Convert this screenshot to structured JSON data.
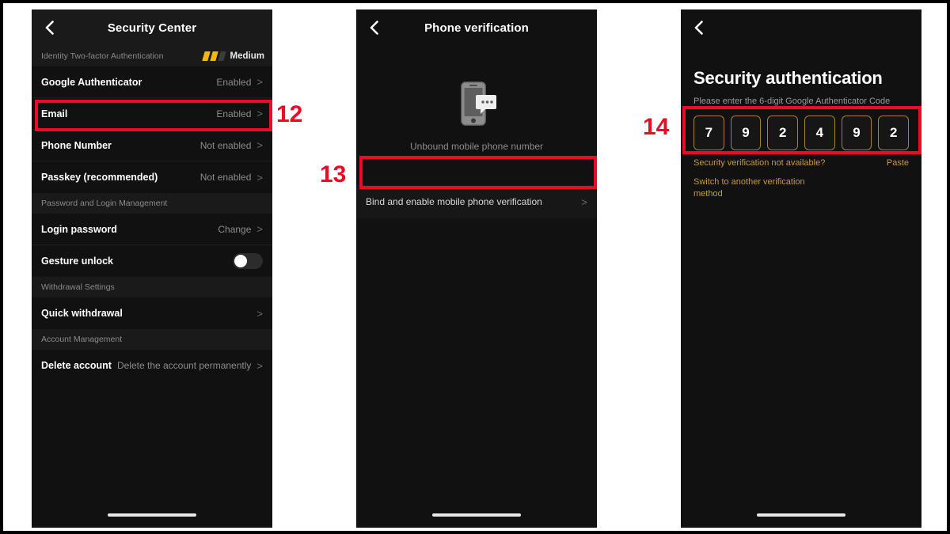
{
  "panels": {
    "security_center": {
      "nav_title": "Security Center",
      "back_icon": "chevron-left-icon",
      "strength_section": {
        "label": "Identity Two-factor Authentication",
        "level": "Medium",
        "bars_filled": 2,
        "bars_total": 3,
        "bar_color": "#f0b90b"
      },
      "rows": [
        {
          "label": "Google Authenticator",
          "value": "Enabled",
          "chevron": ">"
        },
        {
          "label": "Email",
          "value": "Enabled",
          "chevron": ">"
        },
        {
          "label": "Phone Number",
          "value": "Not enabled",
          "chevron": ">"
        },
        {
          "label": "Passkey (recommended)",
          "value": "Not enabled",
          "chevron": ">"
        }
      ],
      "password_section_label": "Password and Login Management",
      "password_rows": [
        {
          "label": "Login password",
          "value": "Change",
          "chevron": ">"
        }
      ],
      "gesture_row": {
        "label": "Gesture unlock",
        "toggle_state": "off"
      },
      "withdrawal_section_label": "Withdrawal Settings",
      "withdrawal_rows": [
        {
          "label": "Quick withdrawal",
          "value": "",
          "chevron": ">"
        }
      ],
      "account_section_label": "Account Management",
      "account_rows": [
        {
          "label": "Delete account",
          "value": "Delete the account permanently",
          "chevron": ">"
        }
      ]
    },
    "phone_verification": {
      "nav_title": "Phone verification",
      "back_icon": "chevron-left-icon",
      "illustration_icon": "phone-message-icon",
      "caption": "Unbound mobile phone number",
      "bind_row": {
        "label": "Bind and enable mobile phone verification",
        "chevron": ">"
      }
    },
    "security_authentication": {
      "back_icon": "chevron-left-icon",
      "title": "Security authentication",
      "subtitle": "Please enter the 6-digit Google Authenticator Code",
      "otp_digits": [
        "7",
        "9",
        "2",
        "4",
        "9",
        "2"
      ],
      "not_available_link": "Security verification not available?",
      "paste_link": "Paste",
      "switch_link": "Switch to another verification method",
      "accent_color": "#c99a3c"
    }
  },
  "annotations": {
    "color": "#ee0a24",
    "markers": [
      {
        "number": "12",
        "target": "email-row"
      },
      {
        "number": "13",
        "target": "bind-and-enable-row"
      },
      {
        "number": "14",
        "target": "otp-input-group"
      }
    ]
  }
}
